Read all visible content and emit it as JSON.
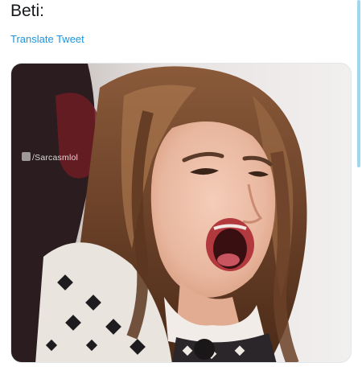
{
  "tweet": {
    "text": "Beti:",
    "translate_label": "Translate Tweet"
  },
  "media": {
    "watermark": "/Sarcasmlol",
    "watermark_icon": "facebook-icon",
    "alt_subject": "woman-yawning-photo"
  },
  "colors": {
    "text": "#14171a",
    "link": "#1b95e0",
    "border": "#e1e8ed",
    "scroll_accent": "#9fd8ee"
  }
}
